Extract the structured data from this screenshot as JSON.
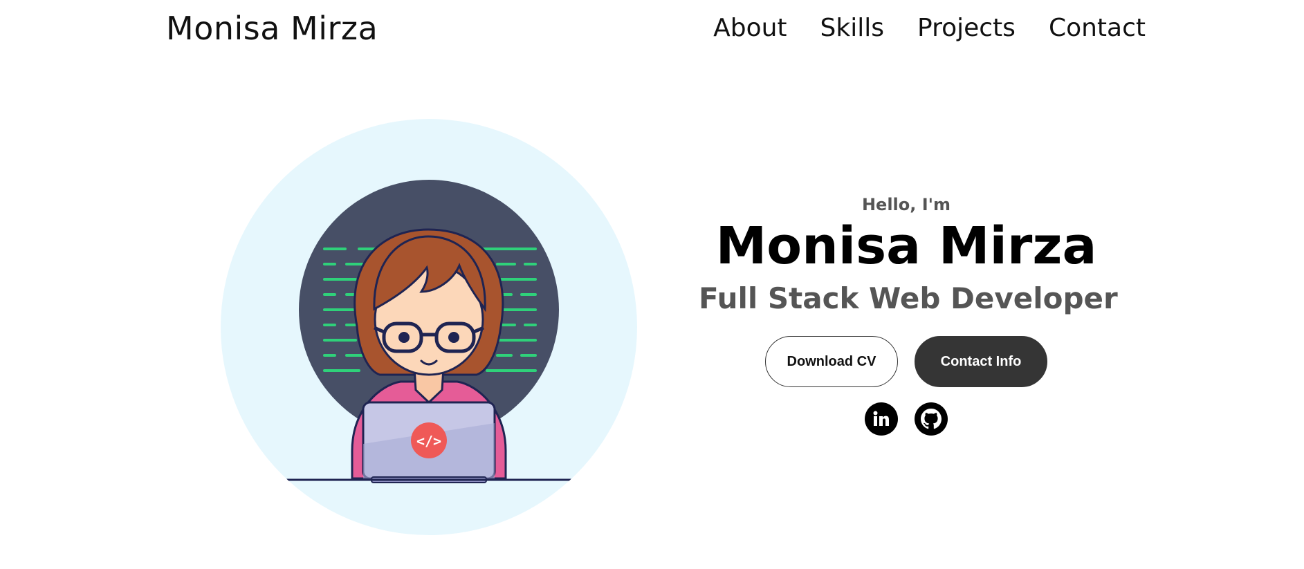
{
  "nav": {
    "logo": "Monisa Mirza",
    "links": [
      {
        "label": "About"
      },
      {
        "label": "Skills"
      },
      {
        "label": "Projects"
      },
      {
        "label": "Contact"
      }
    ]
  },
  "hero": {
    "greeting": "Hello, I'm",
    "name": "Monisa Mirza",
    "role": "Full Stack Web Developer",
    "buttons": {
      "download_cv": "Download CV",
      "contact_info": "Contact Info"
    },
    "laptop_logo_text": "</>",
    "socials": [
      {
        "icon": "linkedin-icon"
      },
      {
        "icon": "github-icon"
      }
    ]
  },
  "colors": {
    "background": "#ffffff",
    "profile_circle": "#e6f7fd",
    "solid_button": "#353535",
    "muted_text": "#555555"
  }
}
